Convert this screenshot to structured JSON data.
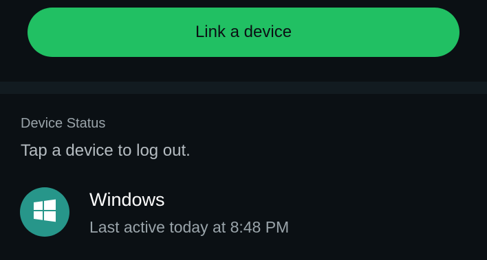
{
  "link_button": {
    "label": "Link a device"
  },
  "device_status": {
    "title": "Device Status",
    "subtitle": "Tap a device to log out."
  },
  "devices": [
    {
      "name": "Windows",
      "last_active": "Last active today at 8:48 PM",
      "icon": "windows-icon"
    }
  ],
  "colors": {
    "background": "#0b1014",
    "accent": "#21c063",
    "avatar": "#27968a",
    "band": "#121b20"
  }
}
